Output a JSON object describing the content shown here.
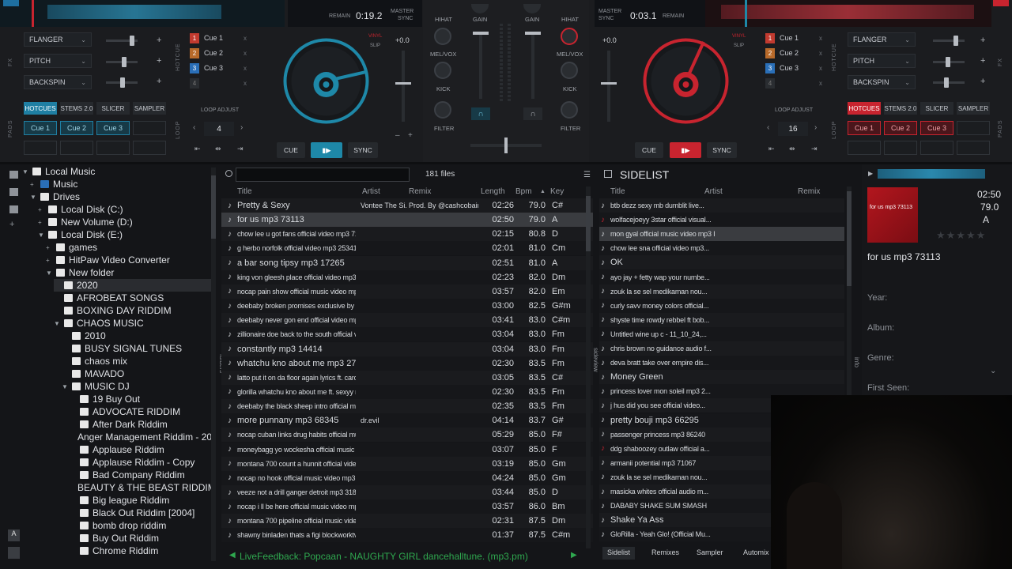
{
  "colors": {
    "accent_left": "#1e88a8",
    "accent_right": "#c8242f",
    "hotcue_left": "#1f7fa3",
    "hotcue_right": "#c8242f",
    "cue1": "#c23a2f",
    "cue2": "#b86a2a",
    "cue3": "#2a6fb8"
  },
  "left_deck": {
    "remain_label": "REMAIN",
    "remain_time": "0:19.2",
    "master_label": "MASTER",
    "sync_label": "SYNC",
    "fx": [
      "FLANGER",
      "PITCH",
      "BACKSPIN"
    ],
    "cues": [
      {
        "num": "1",
        "label": "Cue 1"
      },
      {
        "num": "2",
        "label": "Cue 2"
      },
      {
        "num": "3",
        "label": "Cue 3"
      },
      {
        "num": "4",
        "label": ""
      }
    ],
    "pitch_value": "+0.0",
    "vinyl_label": "VINYL",
    "slip_label": "SLIP",
    "pad_tabs": [
      "HOTCUES",
      "STEMS 2.0",
      "SLICER",
      "SAMPLER"
    ],
    "pads": [
      "Cue 1",
      "Cue 2",
      "Cue 3"
    ],
    "loop_adjust": "LOOP ADJUST",
    "loop_value": "4",
    "cue_btn": "CUE",
    "sync_btn": "SYNC",
    "hotcue_side": "HOTCUE",
    "loop_side": "LOOP",
    "pads_side": "PADS",
    "fx_side": "FX"
  },
  "mixer": {
    "gain": "GAIN",
    "hihat": "HIHAT",
    "melvox": "MEL/VOX",
    "kick": "KICK",
    "filter": "FILTER"
  },
  "right_deck": {
    "remain_label": "REMAIN",
    "remain_time": "0:03.1",
    "master_label": "MASTER",
    "sync_label": "SYNC",
    "fx": [
      "FLANGER",
      "PITCH",
      "BACKSPIN"
    ],
    "cues": [
      {
        "num": "1",
        "label": "Cue 1"
      },
      {
        "num": "2",
        "label": "Cue 2"
      },
      {
        "num": "3",
        "label": "Cue 3"
      },
      {
        "num": "4",
        "label": ""
      }
    ],
    "pitch_value": "+0.0",
    "vinyl_label": "VINYL",
    "slip_label": "SLIP",
    "pad_tabs": [
      "HOTCUES",
      "STEMS 2.0",
      "SLICER",
      "SAMPLER"
    ],
    "pads": [
      "Cue 1",
      "Cue 2",
      "Cue 3"
    ],
    "loop_adjust": "LOOP ADJUST",
    "loop_value": "16",
    "cue_btn": "CUE",
    "sync_btn": "SYNC",
    "hotcue_side": "HOTCUE",
    "loop_side": "LOOP",
    "pads_side": "PADS",
    "fx_side": "FX"
  },
  "folders": [
    {
      "label": "Local Music",
      "ex": "▼",
      "lvl": 0
    },
    {
      "label": "Music",
      "ex": "+",
      "lvl": 1
    },
    {
      "label": "Drives",
      "ex": "▼",
      "lvl": 1
    },
    {
      "label": "Local Disk (C:)",
      "ex": "+",
      "lvl": 2
    },
    {
      "label": "New Volume (D:)",
      "ex": "+",
      "lvl": 2
    },
    {
      "label": "Local Disk (E:)",
      "ex": "▼",
      "lvl": 2
    },
    {
      "label": "games",
      "ex": "+",
      "lvl": 3
    },
    {
      "label": "HitPaw Video Converter",
      "ex": "+",
      "lvl": 3
    },
    {
      "label": "New folder",
      "ex": "▼",
      "lvl": 3
    },
    {
      "label": "2020",
      "ex": "",
      "lvl": 4
    },
    {
      "label": "AFROBEAT SONGS",
      "ex": "",
      "lvl": 4
    },
    {
      "label": "BOXING DAY RIDDIM",
      "ex": "",
      "lvl": 4
    },
    {
      "label": "CHAOS MUSIC",
      "ex": "▼",
      "lvl": 4
    },
    {
      "label": "2010",
      "ex": "",
      "lvl": 5
    },
    {
      "label": "BUSY SIGNAL TUNES",
      "ex": "",
      "lvl": 5
    },
    {
      "label": "chaos mix",
      "ex": "",
      "lvl": 5
    },
    {
      "label": "MAVADO",
      "ex": "",
      "lvl": 5
    },
    {
      "label": "MUSIC DJ",
      "ex": "▼",
      "lvl": 5
    },
    {
      "label": "19 Buy Out",
      "ex": "",
      "lvl": 6
    },
    {
      "label": "ADVOCATE RIDDIM",
      "ex": "",
      "lvl": 6
    },
    {
      "label": "After Dark Riddim",
      "ex": "",
      "lvl": 6
    },
    {
      "label": "Anger Management Riddim - 2004",
      "ex": "",
      "lvl": 6
    },
    {
      "label": "Applause Riddim",
      "ex": "",
      "lvl": 6
    },
    {
      "label": "Applause Riddim - Copy",
      "ex": "",
      "lvl": 6
    },
    {
      "label": "Bad Company Riddim",
      "ex": "",
      "lvl": 6
    },
    {
      "label": "BEAUTY & THE BEAST RIDDIM",
      "ex": "",
      "lvl": 6
    },
    {
      "label": "Big league Riddim",
      "ex": "",
      "lvl": 6
    },
    {
      "label": "Black Out Riddim [2004]",
      "ex": "",
      "lvl": 6
    },
    {
      "label": "bomb drop riddim",
      "ex": "",
      "lvl": 6
    },
    {
      "label": "Buy Out Riddim",
      "ex": "",
      "lvl": 6
    },
    {
      "label": "Chrome Riddim",
      "ex": "",
      "lvl": 6
    }
  ],
  "search": {
    "placeholder": "",
    "count": "181 files"
  },
  "columns": {
    "title": "Title",
    "artist": "Artist",
    "remix": "Remix",
    "length": "Length",
    "bpm": "Bpm",
    "key": "Key"
  },
  "tracks": [
    {
      "title": "Pretty & Sexy",
      "artist": "Vontee The Si...",
      "remix": "Prod. By @cashcobain...",
      "length": "02:26",
      "bpm": "79.0",
      "key": "C#",
      "small": false,
      "sel": false
    },
    {
      "title": "for us mp3 73113",
      "artist": "",
      "remix": "",
      "length": "02:50",
      "bpm": "79.0",
      "key": "A",
      "small": false,
      "sel": true
    },
    {
      "title": "chow lee u got fans official video mp3 71853",
      "artist": "",
      "remix": "",
      "length": "02:15",
      "bpm": "80.8",
      "key": "D",
      "small": true,
      "sel": false
    },
    {
      "title": "g herbo norfolk official video mp3 25341",
      "artist": "",
      "remix": "",
      "length": "02:01",
      "bpm": "81.0",
      "key": "Cm",
      "small": true,
      "sel": false
    },
    {
      "title": "a bar song tipsy mp3 17265",
      "artist": "",
      "remix": "",
      "length": "02:51",
      "bpm": "81.0",
      "key": "A",
      "small": false,
      "sel": false
    },
    {
      "title": "king von gleesh place official video mp3 28...",
      "artist": "",
      "remix": "",
      "length": "02:23",
      "bpm": "82.0",
      "key": "Dm",
      "small": true,
      "sel": false
    },
    {
      "title": "nocap pain show official music video mp3 3...",
      "artist": "",
      "remix": "",
      "length": "03:57",
      "bpm": "82.0",
      "key": "Em",
      "small": true,
      "sel": false
    },
    {
      "title": "deebaby broken promises exclusive by half...",
      "artist": "",
      "remix": "",
      "length": "03:00",
      "bpm": "82.5",
      "key": "G#m",
      "small": true,
      "sel": false
    },
    {
      "title": "deebaby never gon end official video mp3...",
      "artist": "",
      "remix": "",
      "length": "03:41",
      "bpm": "83.0",
      "key": "C#m",
      "small": true,
      "sel": false
    },
    {
      "title": "zillionaire doe back to the south official vide...",
      "artist": "",
      "remix": "",
      "length": "03:04",
      "bpm": "83.0",
      "key": "Fm",
      "small": true,
      "sel": false
    },
    {
      "title": "constantly mp3 14414",
      "artist": "",
      "remix": "",
      "length": "03:04",
      "bpm": "83.0",
      "key": "Fm",
      "small": false,
      "sel": false
    },
    {
      "title": "whatchu kno about me mp3 27934",
      "artist": "",
      "remix": "",
      "length": "02:30",
      "bpm": "83.5",
      "key": "Fm",
      "small": false,
      "sel": false
    },
    {
      "title": "latto put it on da floor again lyrics ft. cardi b...",
      "artist": "",
      "remix": "",
      "length": "03:05",
      "bpm": "83.5",
      "key": "C#",
      "small": true,
      "sel": false
    },
    {
      "title": "glorilla whatchu kno about me ft. sexyy red...",
      "artist": "",
      "remix": "",
      "length": "02:30",
      "bpm": "83.5",
      "key": "Fm",
      "small": true,
      "sel": false
    },
    {
      "title": "deebaby the black sheep intro official musi...",
      "artist": "",
      "remix": "",
      "length": "02:35",
      "bpm": "83.5",
      "key": "Fm",
      "small": true,
      "sel": false
    },
    {
      "title": "more punnany mp3 68345",
      "artist": "dr.evil",
      "remix": "",
      "length": "04:14",
      "bpm": "83.7",
      "key": "G#",
      "small": false,
      "sel": false
    },
    {
      "title": "nocap cuban links drug habits official music...",
      "artist": "",
      "remix": "",
      "length": "05:29",
      "bpm": "85.0",
      "key": "F#",
      "small": true,
      "sel": false
    },
    {
      "title": "moneybagg yo wockesha official music vid...",
      "artist": "",
      "remix": "",
      "length": "03:07",
      "bpm": "85.0",
      "key": "F",
      "small": true,
      "sel": false
    },
    {
      "title": "montana 700 count a hunnit official video...",
      "artist": "",
      "remix": "",
      "length": "03:19",
      "bpm": "85.0",
      "key": "Gm",
      "small": true,
      "sel": false
    },
    {
      "title": "nocap no hook official music video mp3 31...",
      "artist": "",
      "remix": "",
      "length": "04:24",
      "bpm": "85.0",
      "key": "Gm",
      "small": true,
      "sel": false
    },
    {
      "title": "veeze not a drill ganger detroit mp3 31893",
      "artist": "",
      "remix": "",
      "length": "03:44",
      "bpm": "85.0",
      "key": "D",
      "small": true,
      "sel": false
    },
    {
      "title": "nocap i ll be here official music video mp3...",
      "artist": "",
      "remix": "",
      "length": "03:57",
      "bpm": "86.0",
      "key": "Bm",
      "small": true,
      "sel": false
    },
    {
      "title": "montana 700 pipeline official music video...",
      "artist": "",
      "remix": "",
      "length": "02:31",
      "bpm": "87.5",
      "key": "Dm",
      "small": true,
      "sel": false
    },
    {
      "title": "shawny binladen thats a figi blockworktv pe...",
      "artist": "",
      "remix": "",
      "length": "01:37",
      "bpm": "87.5",
      "key": "C#m",
      "small": true,
      "sel": false
    }
  ],
  "live_feedback": "LiveFeedback: Popcaan - NAUGHTY GIRL dancehalltune. (mp3.pm)",
  "sidelist": {
    "title": "SIDELIST",
    "columns": {
      "title": "Title",
      "artist": "Artist",
      "remix": "Remix"
    },
    "items": [
      {
        "title": "btb dezz sexy mb dumblit live...",
        "small": true
      },
      {
        "title": "wolfacejoeyy 3star official visual...",
        "small": true
      },
      {
        "title": "mon gyal official music video mp3 I",
        "small": true
      },
      {
        "title": "chow lee sna official video mp3...",
        "small": true
      },
      {
        "title": "OK",
        "small": false
      },
      {
        "title": "ayo jay + fetty wap your numbe...",
        "small": true
      },
      {
        "title": "zouk la se sel medikaman nou...",
        "small": true
      },
      {
        "title": "curly savv money colors official...",
        "small": true
      },
      {
        "title": "shyste time rowdy rebbel ft bob...",
        "small": true
      },
      {
        "title": "Untitled  wine up c - 11_10_24,...",
        "small": true
      },
      {
        "title": "chris brown no guidance audio f...",
        "small": true
      },
      {
        "title": "deva bratt take over empire dis...",
        "small": true
      },
      {
        "title": "Money Green",
        "small": false
      },
      {
        "title": "princess lover mon soleil mp3 2...",
        "small": true
      },
      {
        "title": "j hus did you see official video...",
        "small": true
      },
      {
        "title": "pretty bouji mp3 66295",
        "small": false
      },
      {
        "title": "passenger princess mp3 86240",
        "small": true
      },
      {
        "title": "ddg shaboozey outlaw official a...",
        "small": true
      },
      {
        "title": "armanii potential mp3 71067",
        "small": true
      },
      {
        "title": "zouk la se sel medikaman nou...",
        "small": true
      },
      {
        "title": "masicka whites official audio m...",
        "small": true
      },
      {
        "title": "DABABY SHAKE SUM SMASH",
        "small": true
      },
      {
        "title": "Shake Ya Ass",
        "small": false
      },
      {
        "title": "GloRilla - Yeah Glo! (Official Mu...",
        "small": true
      }
    ],
    "tabs": [
      "Sidelist",
      "Remixes",
      "Sampler",
      "Automix"
    ]
  },
  "info": {
    "cover_text": "for us mp3 73113",
    "length": "02:50",
    "bpm": "79.0",
    "key": "A",
    "title": "for us mp3 73113",
    "fields": [
      "Year:",
      "Album:",
      "Genre:",
      "First Seen:"
    ]
  },
  "side_labels": {
    "folders": "folders",
    "sideview": "sideview",
    "info": "info"
  }
}
